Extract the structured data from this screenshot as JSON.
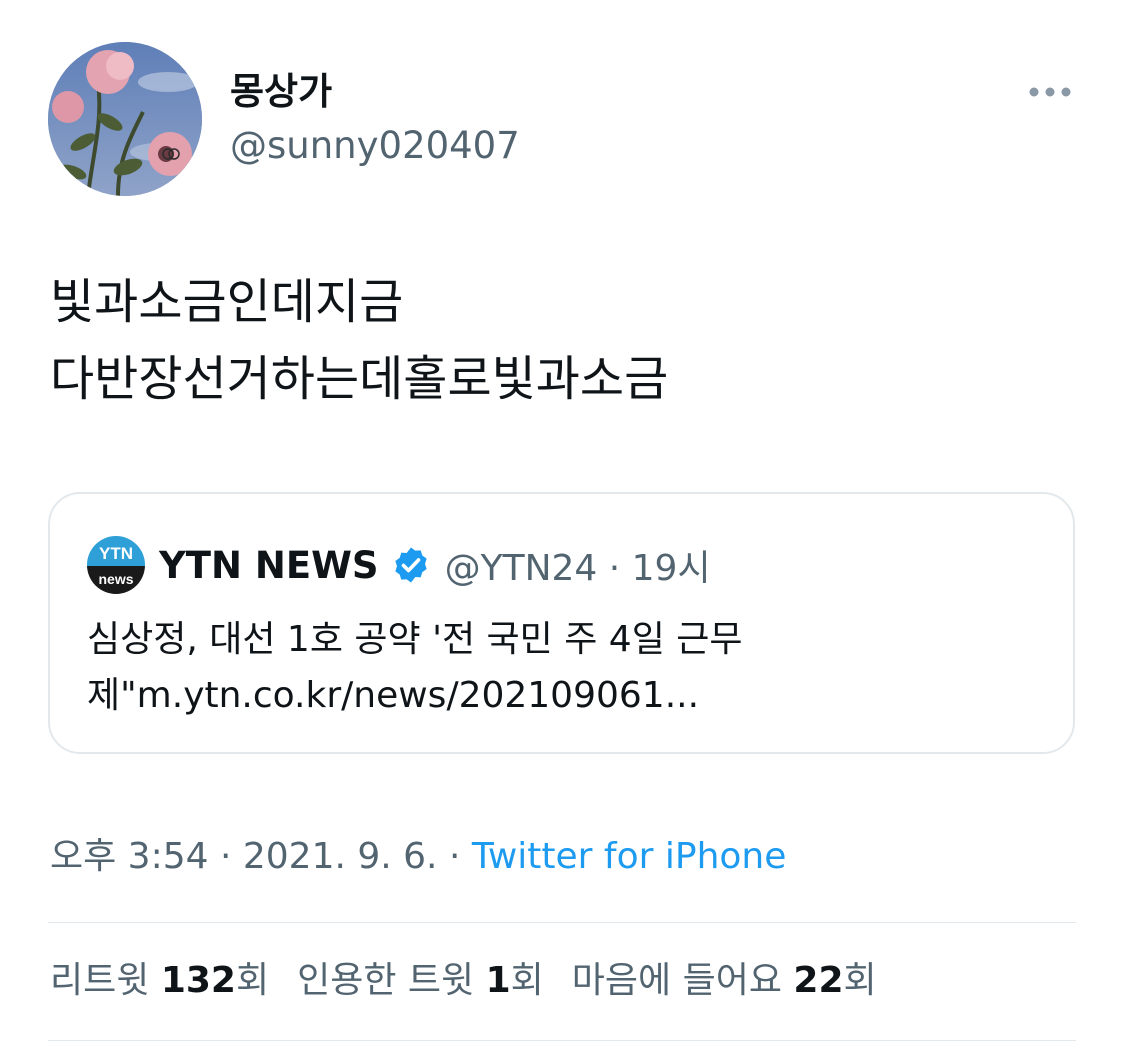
{
  "author": {
    "display_name": "몽상가",
    "handle": "@sunny020407"
  },
  "tweet": {
    "lines": [
      "빛과소금인데지금",
      "다반장선거하는데홀로빛과소금"
    ]
  },
  "quote": {
    "avatar_text_top": "YTN",
    "avatar_text_bottom": "news",
    "name": "YTN NEWS",
    "handle_time": "@YTN24 · 19시",
    "lines": [
      "심상정, 대선 1호 공약 '전 국민 주 4일 근무",
      "제\"m.ytn.co.kr/news/202109061..."
    ]
  },
  "meta": {
    "time": "오후 3:54 · 2021. 9. 6. · ",
    "source": "Twitter for iPhone"
  },
  "stats": {
    "retweets_label": "리트윗 ",
    "retweets": "132",
    "retweets_suffix": "회",
    "quotes_label": "인용한 트윗 ",
    "quotes": "1",
    "quotes_suffix": "회",
    "likes_label": "마음에 들어요 ",
    "likes": "22",
    "likes_suffix": "회"
  },
  "colors": {
    "accent": "#1d9bf0",
    "secondary_text": "#536471",
    "border": "#e3e8ec"
  },
  "icons": {
    "more": "more-horizontal-icon",
    "verified": "verified-badge-icon"
  }
}
